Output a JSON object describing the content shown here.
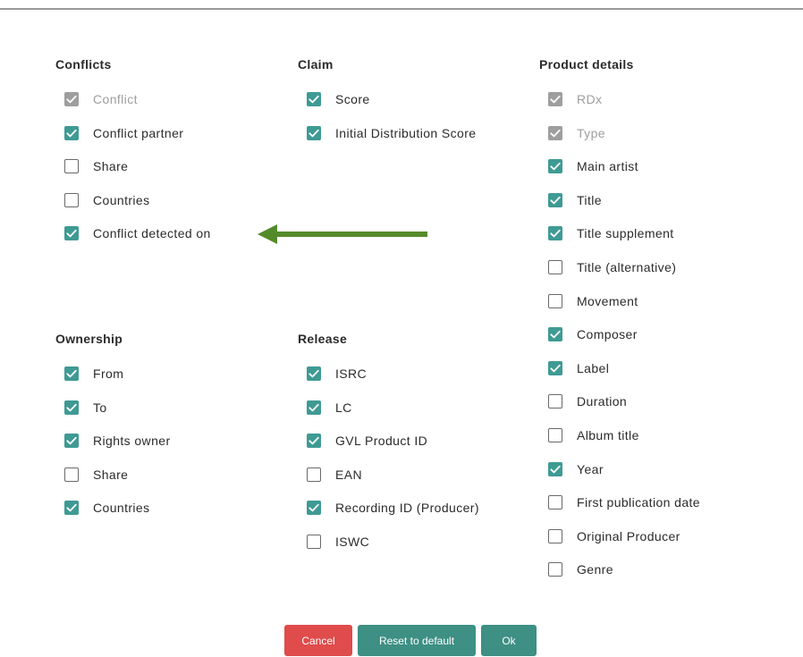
{
  "sections": {
    "conflicts": {
      "title": "Conflicts",
      "items": [
        {
          "label": "Conflict",
          "state": "disabled"
        },
        {
          "label": "Conflict partner",
          "state": "checked"
        },
        {
          "label": "Share",
          "state": "unchecked"
        },
        {
          "label": "Countries",
          "state": "unchecked"
        },
        {
          "label": "Conflict detected on",
          "state": "checked"
        }
      ]
    },
    "claim": {
      "title": "Claim",
      "items": [
        {
          "label": "Score",
          "state": "checked"
        },
        {
          "label": "Initial Distribution Score",
          "state": "checked"
        }
      ]
    },
    "product_details": {
      "title": "Product details",
      "items": [
        {
          "label": "RDx",
          "state": "disabled"
        },
        {
          "label": "Type",
          "state": "disabled"
        },
        {
          "label": "Main artist",
          "state": "checked"
        },
        {
          "label": "Title",
          "state": "checked"
        },
        {
          "label": "Title supplement",
          "state": "checked"
        },
        {
          "label": "Title (alternative)",
          "state": "unchecked"
        },
        {
          "label": "Movement",
          "state": "unchecked"
        },
        {
          "label": "Composer",
          "state": "checked"
        },
        {
          "label": "Label",
          "state": "checked"
        },
        {
          "label": "Duration",
          "state": "unchecked"
        },
        {
          "label": "Album title",
          "state": "unchecked"
        },
        {
          "label": "Year",
          "state": "checked"
        },
        {
          "label": "First publication date",
          "state": "unchecked"
        },
        {
          "label": "Original Producer",
          "state": "unchecked"
        },
        {
          "label": "Genre",
          "state": "unchecked"
        }
      ]
    },
    "ownership": {
      "title": "Ownership",
      "items": [
        {
          "label": "From",
          "state": "checked"
        },
        {
          "label": "To",
          "state": "checked"
        },
        {
          "label": "Rights owner",
          "state": "checked"
        },
        {
          "label": "Share",
          "state": "unchecked"
        },
        {
          "label": "Countries",
          "state": "checked"
        }
      ]
    },
    "release": {
      "title": "Release",
      "items": [
        {
          "label": "ISRC",
          "state": "checked"
        },
        {
          "label": "LC",
          "state": "checked"
        },
        {
          "label": "GVL Product ID",
          "state": "checked"
        },
        {
          "label": "EAN",
          "state": "unchecked"
        },
        {
          "label": "Recording ID (Producer)",
          "state": "checked"
        },
        {
          "label": "ISWC",
          "state": "unchecked"
        }
      ]
    }
  },
  "buttons": {
    "cancel": "Cancel",
    "reset": "Reset to default",
    "ok": "Ok"
  },
  "colors": {
    "checked": "#3f9a94",
    "disabled": "#9e9e9e",
    "cancel": "#e04b4b",
    "primary": "#3e8f84",
    "arrow": "#548b2a"
  },
  "annotation": {
    "arrow_icon": "left-arrow-icon"
  }
}
